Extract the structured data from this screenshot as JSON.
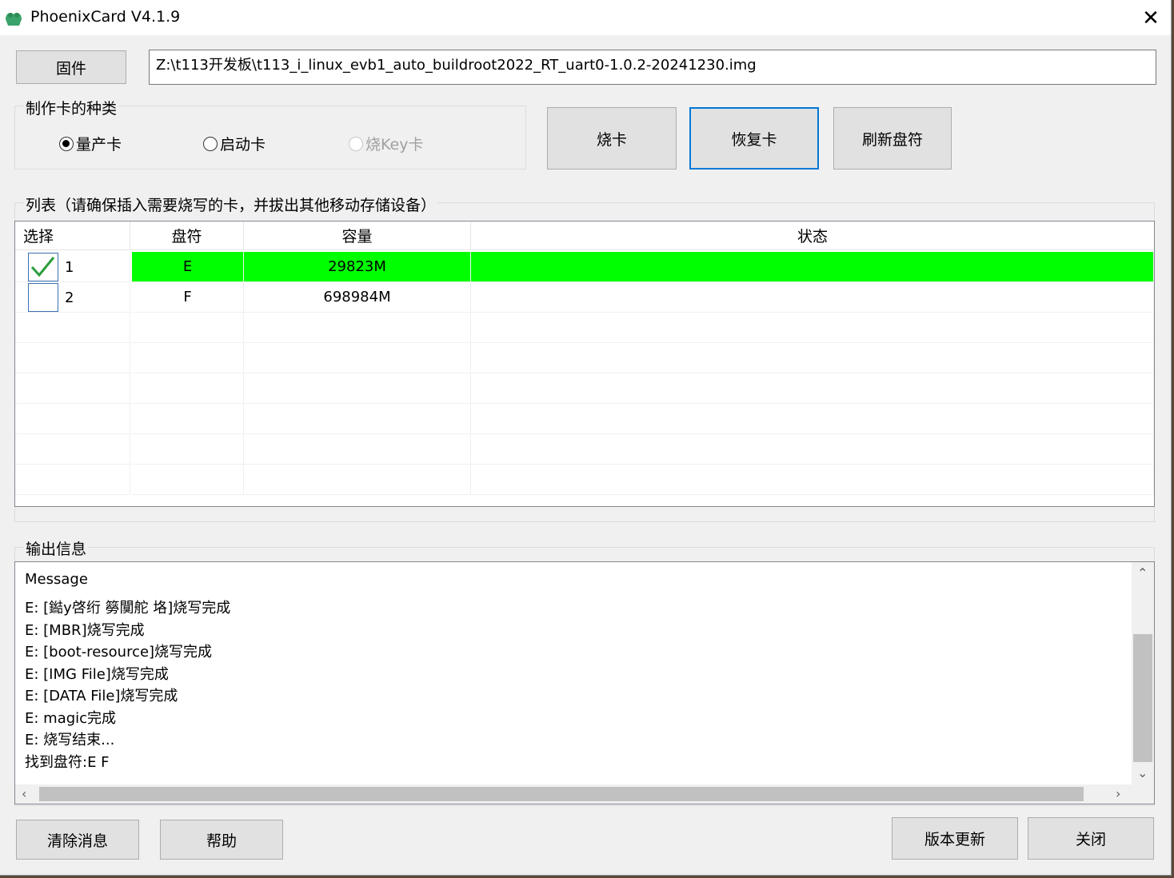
{
  "window": {
    "title": "PhoenixCard V4.1.9"
  },
  "firmware": {
    "button_label": "固件",
    "path": "Z:\\t113开发板\\t113_i_linux_evb1_auto_buildroot2022_RT_uart0-1.0.2-20241230.img"
  },
  "card_type": {
    "group_label": "制作卡的种类",
    "options": [
      {
        "label": "量产卡",
        "selected": true,
        "enabled": true
      },
      {
        "label": "启动卡",
        "selected": false,
        "enabled": true
      },
      {
        "label": "烧Key卡",
        "selected": false,
        "enabled": false
      }
    ]
  },
  "actions": {
    "burn": "烧卡",
    "restore": "恢复卡",
    "refresh": "刷新盘符"
  },
  "disk_list": {
    "group_label": "列表（请确保插入需要烧写的卡，并拔出其他移动存储设备）",
    "columns": [
      "选择",
      "盘符",
      "容量",
      "状态"
    ],
    "rows": [
      {
        "checked": true,
        "index": "1",
        "drive": "E",
        "capacity": "29823M",
        "status": "",
        "status_color": "#00ff00"
      },
      {
        "checked": false,
        "index": "2",
        "drive": "F",
        "capacity": "698984M",
        "status": "",
        "status_color": ""
      }
    ]
  },
  "output": {
    "group_label": "输出信息",
    "lines": [
      "Message",
      "E: [鐑у啓绗   簩闃舵 垎]烧写完成",
      "E: [MBR]烧写完成",
      "E: [boot-resource]烧写完成",
      "E: [IMG File]烧写完成",
      "E: [DATA File]烧写完成",
      "E: magic完成",
      "E: 烧写结束...",
      "找到盘符:E F"
    ]
  },
  "bottom_buttons": {
    "clear": "清除消息",
    "help": "帮助",
    "update": "版本更新",
    "close": "关闭"
  },
  "colors": {
    "accent": "#0078d7",
    "status_ok": "#00ff00"
  }
}
